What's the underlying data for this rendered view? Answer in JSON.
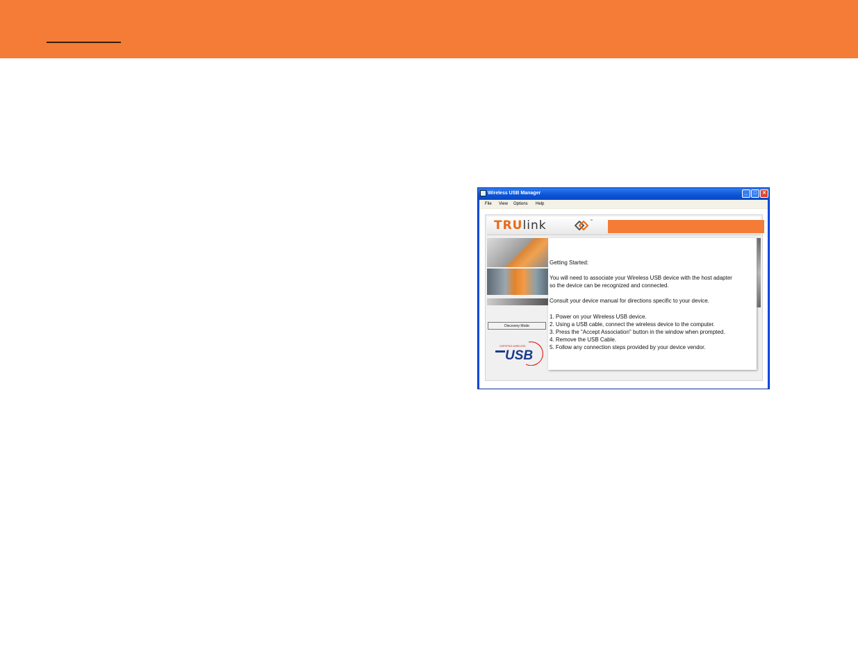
{
  "colors": {
    "banner": "#f47c36",
    "xp_blue": "#0a4ee0",
    "close_red": "#e0462c"
  },
  "window": {
    "title": "Wireless USB Manager",
    "controls": {
      "minimize": "_",
      "maximize": "□",
      "close": "✕"
    },
    "menu": [
      "File",
      "View",
      "Options",
      "Help"
    ]
  },
  "logo": {
    "tru": "TRU",
    "link": "link",
    "tm": "™"
  },
  "left_panel": {
    "discovery_button": "Discovery Mode",
    "usb_logo_text": "USB",
    "usb_logo_subtext": "CERTIFIED WIRELESS"
  },
  "content": {
    "heading": "Getting Started:",
    "para1_line1": "You will need to associate your Wireless USB device with the host adapter",
    "para1_line2": "so the device can be recognized and connected.",
    "para2": "Consult your device manual for directions specific to your device.",
    "steps": [
      "1.  Power on your Wireless USB device.",
      "2.  Using a USB cable, connect the wireless device to the computer.",
      "3.  Press the \"Accept Association\" button in the window when prompted.",
      "4.  Remove the USB Cable.",
      "5.  Follow any connection steps provided by your device vendor."
    ]
  },
  "icons": [
    "app-icon",
    "minimize-icon",
    "maximize-icon",
    "close-icon",
    "trulink-logo-mark-icon",
    "usb-logo-icon"
  ]
}
